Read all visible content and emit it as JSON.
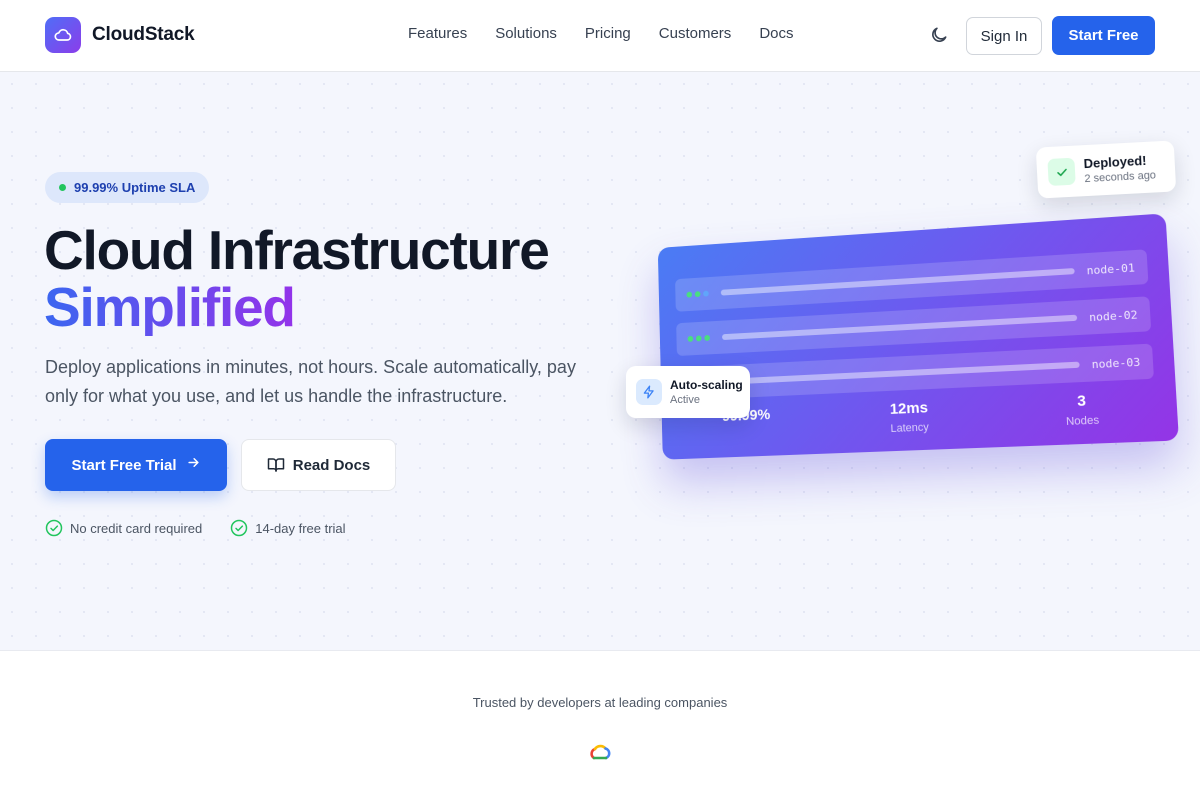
{
  "brand": {
    "name": "CloudStack",
    "logo_icon": "cloud-icon",
    "gradient": [
      "#4f6ef7",
      "#8b3dea"
    ]
  },
  "nav": {
    "links": [
      "Features",
      "Solutions",
      "Pricing",
      "Customers",
      "Docs"
    ],
    "theme_toggle_icon": "moon-icon",
    "sign_in": "Sign In",
    "start_free": "Start Free"
  },
  "hero": {
    "badge": "99.99% Uptime SLA",
    "headline_line1": "Cloud Infrastructure",
    "headline_line2": "Simplified",
    "subtitle": "Deploy applications in minutes, not hours. Scale automatically, pay only for what you use, and let us handle the infrastructure.",
    "primary_cta": "Start Free Trial",
    "secondary_cta": "Read Docs",
    "perks": [
      "No credit card required",
      "14-day free trial"
    ]
  },
  "dashboard": {
    "nodes": [
      {
        "name": "node-01",
        "dots": [
          "#4ade80",
          "#4ade80",
          "#60a5fa"
        ]
      },
      {
        "name": "node-02",
        "dots": [
          "#4ade80",
          "#4ade80",
          "#4ade80"
        ]
      },
      {
        "name": "node-03",
        "dots": [
          "#4ade80",
          "#facc15",
          "#4ade80"
        ]
      }
    ],
    "stats": [
      {
        "value": "99.99%",
        "label": ""
      },
      {
        "value": "12ms",
        "label": "Latency"
      },
      {
        "value": "3",
        "label": "Nodes"
      }
    ],
    "toast_deployed": {
      "title": "Deployed!",
      "subtitle": "2 seconds ago",
      "icon": "check-icon"
    },
    "toast_scaling": {
      "title": "Auto-scaling",
      "subtitle": "Active",
      "icon": "bolt-icon"
    }
  },
  "trusted": {
    "text": "Trusted by developers at leading companies",
    "logo_icon": "multicolor-cloud-logo-icon"
  },
  "colors": {
    "primary": "#2563eb",
    "success": "#22c55e",
    "heading": "#111827",
    "body": "#4b5563"
  }
}
